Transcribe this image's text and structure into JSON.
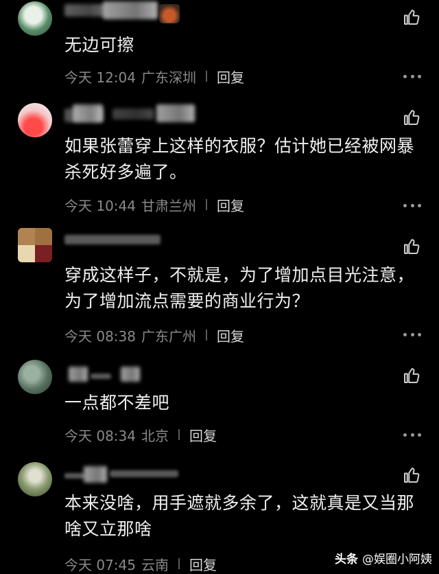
{
  "comments": [
    {
      "text": "无边可擦",
      "time": "今天 12:04",
      "location": "广东深圳",
      "reply_label": "回复"
    },
    {
      "text": "如果张蕾穿上这样的衣服？估计她已经被网暴杀死好多遍了。",
      "time": "今天 10:44",
      "location": "甘肃兰州",
      "reply_label": "回复"
    },
    {
      "text": "穿成这样子，不就是，为了增加点目光注意，为了增加流点需要的商业行为？",
      "time": "今天 08:38",
      "location": "广东广州",
      "reply_label": "回复"
    },
    {
      "text": "一点都不差吧",
      "time": "今天 08:34",
      "location": "北京",
      "reply_label": "回复"
    },
    {
      "text": "本来没啥，用手遮就多余了，这就真是又当那啥又立那啥",
      "time": "今天 07:45",
      "location": "云南",
      "reply_label": "回复"
    }
  ],
  "icons": {
    "like": "thumbs-up-icon",
    "more": "more-dots-icon"
  },
  "watermark": {
    "brand": "头条",
    "account": "@娱圈小阿姨"
  },
  "colors": {
    "background": "#000000",
    "text": "#f0f0f0",
    "meta": "#8a8a8a",
    "reply": "#d8d8d8"
  }
}
